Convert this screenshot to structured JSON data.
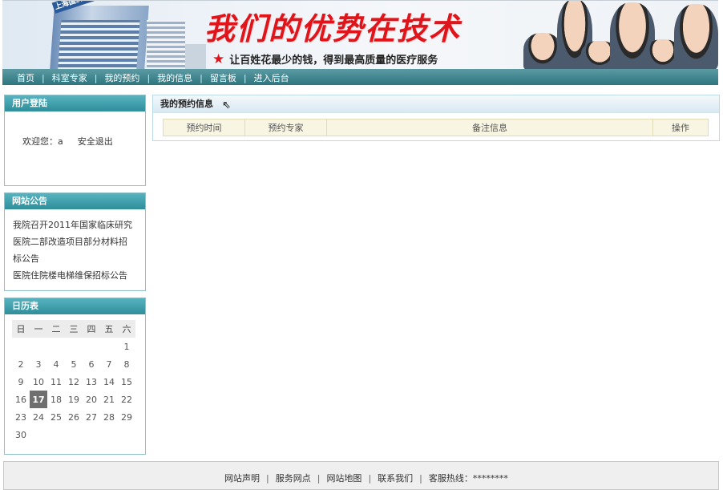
{
  "banner": {
    "sign_text": "上海国济男子医院",
    "slogan": "我们的优势在技术",
    "subtitle": "让百姓花最少的钱，得到最高质量的医疗服务"
  },
  "nav": {
    "items": [
      "首页",
      "科室专家",
      "我的预约",
      "我的信息",
      "留言板",
      "进入后台"
    ]
  },
  "login_panel": {
    "title": "用户登陆",
    "welcome": "欢迎您：a",
    "logout": "安全退出"
  },
  "notice_panel": {
    "title": "网站公告",
    "items": [
      "我院召开2011年国家临床研究",
      "医院二部改造项目部分材料招标公告",
      "医院住院楼电梯维保招标公告"
    ]
  },
  "calendar": {
    "title": "日历表",
    "weekdays": [
      "日",
      "一",
      "二",
      "三",
      "四",
      "五",
      "六"
    ],
    "weeks": [
      [
        "",
        "",
        "",
        "",
        "",
        "",
        "1"
      ],
      [
        "2",
        "3",
        "4",
        "5",
        "6",
        "7",
        "8"
      ],
      [
        "9",
        "10",
        "11",
        "12",
        "13",
        "14",
        "15"
      ],
      [
        "16",
        "17",
        "18",
        "19",
        "20",
        "21",
        "22"
      ],
      [
        "23",
        "24",
        "25",
        "26",
        "27",
        "28",
        "29"
      ],
      [
        "30",
        "",
        "",
        "",
        "",
        "",
        ""
      ]
    ],
    "today": "17"
  },
  "main": {
    "title": "我的预约信息",
    "columns": [
      "预约时间",
      "预约专家",
      "备注信息",
      "操作"
    ]
  },
  "footer": {
    "links": [
      "网站声明",
      "服务网点",
      "网站地图",
      "联系我们"
    ],
    "hotline": "客服热线：********"
  },
  "colors": {
    "nav_bg": "#2e767f",
    "panel_title": "#3a9aa6",
    "slogan_red": "#e0151b",
    "today_bg": "#6f6f6f"
  }
}
